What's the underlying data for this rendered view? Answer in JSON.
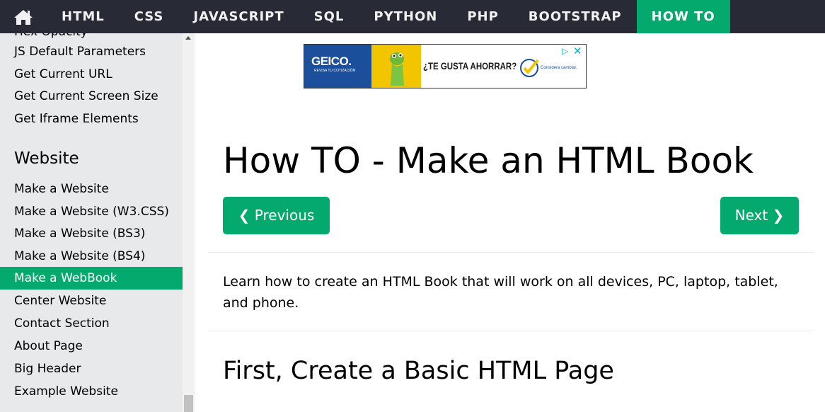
{
  "topnav": {
    "home_icon": "home-icon",
    "links": [
      "HTML",
      "CSS",
      "JAVASCRIPT",
      "SQL",
      "PYTHON",
      "PHP",
      "BOOTSTRAP",
      "HOW TO"
    ],
    "active": "HOW TO",
    "bg_color": "#282a35",
    "accent_color": "#04aa6d"
  },
  "sidebar": {
    "clipped_item": "Hex Opacity",
    "items_top": [
      "JS Default Parameters",
      "Get Current URL",
      "Get Current Screen Size",
      "Get Iframe Elements"
    ],
    "section_heading": "Website",
    "items_website": [
      "Make a Website",
      "Make a Website (W3.CSS)",
      "Make a Website (BS3)",
      "Make a Website (BS4)",
      "Make a WebBook",
      "Center Website",
      "Contact Section",
      "About Page",
      "Big Header",
      "Example Website"
    ],
    "active_item": "Make a WebBook"
  },
  "ad": {
    "brand": "GEICO.",
    "brand_sub": "REVISA TU COTIZACIÓN",
    "headline": "¿TE GUSTA AHORRAR?",
    "small_text": "Considera cambiar."
  },
  "main": {
    "title": "How TO - Make an HTML Book",
    "prev_label": "❮ Previous",
    "next_label": "Next ❯",
    "intro": "Learn how to create an HTML Book that will work on all devices, PC, laptop, tablet, and phone.",
    "section_title": "First, Create a Basic HTML Page"
  }
}
